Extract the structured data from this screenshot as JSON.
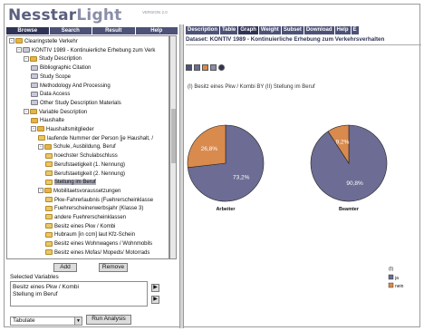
{
  "app": {
    "logo_main": "Nesstar",
    "logo_sub": "Light",
    "version": "VERSION 2.0"
  },
  "left_tabs": [
    "Browse",
    "Search",
    "Result",
    "Help"
  ],
  "tree": [
    {
      "label": "Clearingstelle Verkehr",
      "level": 0,
      "icon": "folder",
      "exp": "-"
    },
    {
      "label": "KONTIV 1989 - Kontinuierliche Erhebung zum Verk",
      "level": 1,
      "icon": "doc",
      "exp": "-"
    },
    {
      "label": "Study Description",
      "level": 2,
      "icon": "folder",
      "exp": "-"
    },
    {
      "label": "Bibliographic Citation",
      "level": 3,
      "icon": "doc",
      "exp": ""
    },
    {
      "label": "Study Scope",
      "level": 3,
      "icon": "doc",
      "exp": ""
    },
    {
      "label": "Methodology And Processing",
      "level": 3,
      "icon": "doc",
      "exp": ""
    },
    {
      "label": "Data Access",
      "level": 3,
      "icon": "doc",
      "exp": ""
    },
    {
      "label": "Other Study Description Materials",
      "level": 3,
      "icon": "doc",
      "exp": ""
    },
    {
      "label": "Variable Description",
      "level": 2,
      "icon": "folder",
      "exp": "-"
    },
    {
      "label": "Haushalte",
      "level": 3,
      "icon": "folder",
      "exp": ""
    },
    {
      "label": "Haushaltsmitglieder",
      "level": 3,
      "icon": "folder",
      "exp": "-"
    },
    {
      "label": "laufende Nummer der Person [je Haushalt, /",
      "level": 4,
      "icon": "var",
      "exp": ""
    },
    {
      "label": "Schule, Ausbildung, Beruf",
      "level": 4,
      "icon": "folder",
      "exp": "-"
    },
    {
      "label": "hoechster Schulabschluss",
      "level": 5,
      "icon": "var",
      "exp": ""
    },
    {
      "label": "Berufstaetigkeit (1. Nennung)",
      "level": 5,
      "icon": "var",
      "exp": ""
    },
    {
      "label": "Berufstaetigkeit (2. Nennung)",
      "level": 5,
      "icon": "var",
      "exp": ""
    },
    {
      "label": "Stellung im Beruf",
      "level": 5,
      "icon": "var",
      "exp": "",
      "selected": true
    },
    {
      "label": "Mobilitaetsvoraussetzungen",
      "level": 4,
      "icon": "folder",
      "exp": "-"
    },
    {
      "label": "Pkw-Fahrerlaubnis (Fuehrerscheinklasse",
      "level": 5,
      "icon": "var",
      "exp": ""
    },
    {
      "label": "Fuehrerscheinerwerbsjahr (Klasse 3)",
      "level": 5,
      "icon": "var",
      "exp": ""
    },
    {
      "label": "andere Fuehrerscheinklassen",
      "level": 5,
      "icon": "var",
      "exp": ""
    },
    {
      "label": "Besitz eines Pkw / Kombi",
      "level": 5,
      "icon": "var",
      "exp": ""
    },
    {
      "label": "Hubraum [in ccm] laut Kfz-Schein",
      "level": 5,
      "icon": "var",
      "exp": ""
    },
    {
      "label": "Besitz eines Wohnwagens / Wohnmobils",
      "level": 5,
      "icon": "var",
      "exp": ""
    },
    {
      "label": "Besitz eines Mofas/ Mopeds/ Motorrads",
      "level": 5,
      "icon": "var",
      "exp": ""
    }
  ],
  "buttons": {
    "add": "Add",
    "remove": "Remove",
    "run": "Run Analysis"
  },
  "selected_label": "Selected Variables",
  "selected_variables": [
    "Besitz eines Pkw / Kombi",
    "Stellung im Beruf"
  ],
  "tabulate_value": "Tabulate",
  "right_tabs": [
    "Description",
    "Table",
    "Graph",
    "Weight",
    "Subset",
    "Download",
    "Help",
    "E"
  ],
  "active_right_tab": "Graph",
  "dataset_title": "Dataset: KONTIV 1989 - Kontinuierliche Erhebung zum Verkehrsverhalten",
  "chart_caption": "(I) Besitz eines Pkw / Kombi BY (II) Stellung im Beruf",
  "colors": {
    "ja": "#6c6c94",
    "nein": "#d98a4d",
    "nav": "#4d5276",
    "nav_active": "#2f3456"
  },
  "chart_data": {
    "type": "pie",
    "charts": [
      {
        "category": "Arbeiter",
        "slices": [
          {
            "name": "ja",
            "value": 73.2,
            "label": "73,2%"
          },
          {
            "name": "nein",
            "value": 26.8,
            "label": "26,8%"
          }
        ]
      },
      {
        "category": "Beamter",
        "slices": [
          {
            "name": "ja",
            "value": 90.8,
            "label": "90,8%"
          },
          {
            "name": "nein",
            "value": 9.2,
            "label": "9,2%"
          }
        ]
      }
    ],
    "legend_title": "(I)",
    "legend": [
      "ja",
      "nein"
    ],
    "legend_position": "bottom-right"
  }
}
